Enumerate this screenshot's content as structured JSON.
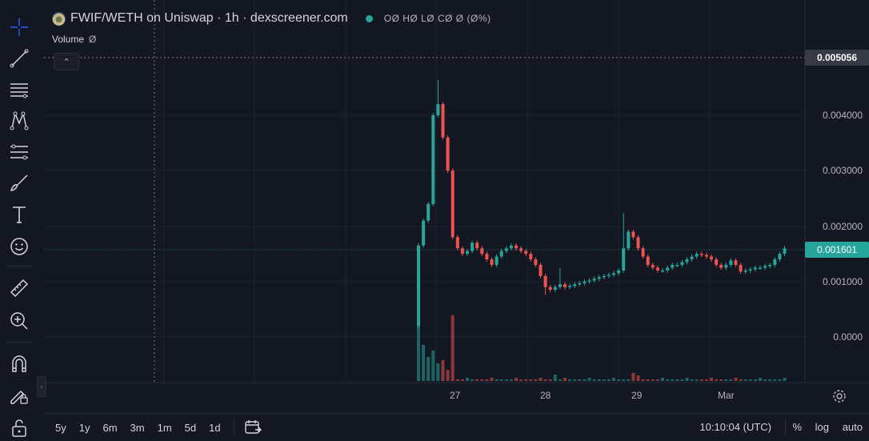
{
  "header": {
    "title": "FWIF/WETH on Uniswap · 1h · dexscreener.com",
    "ohlc": "OØ HØ LØ CØ Ø (Ø%)",
    "volume_label": "Volume",
    "volume_value": "Ø",
    "collapse_glyph": "⌃"
  },
  "toolbar": {
    "items": [
      "crosshair-icon",
      "trendline-icon",
      "horizontal-lines-icon",
      "pattern-icon",
      "fib-icon",
      "brush-icon",
      "text-icon",
      "emoji-icon",
      "ruler-icon",
      "zoom-in-icon",
      "magnet-icon",
      "lock-drawing-icon",
      "lock-icon"
    ],
    "collapse_glyph": "‹"
  },
  "colors": {
    "up": "#26a69a",
    "down": "#ef5350",
    "background": "#131722",
    "grid": "#1e222d",
    "price_tag": "#26a69a",
    "crosshair_tag": "#363a45"
  },
  "price_axis": {
    "labels": [
      "0.004000",
      "0.003000",
      "0.002000",
      "0.001000",
      "0.0000"
    ],
    "crosshair_price": "0.005056",
    "last_price": "0.001601"
  },
  "time_axis": {
    "labels": [
      "27",
      "28",
      "29",
      "Mar"
    ]
  },
  "bottom": {
    "timeframes": [
      "5y",
      "1y",
      "6m",
      "3m",
      "1m",
      "5d",
      "1d"
    ],
    "clock": "10:10:04 (UTC)",
    "percent": "%",
    "log": "log",
    "auto": "auto"
  },
  "chart_data": {
    "type": "candlestick",
    "interval": "1h",
    "price_axis": [
      0,
      0.005056
    ],
    "close_approx": [
      0.00165,
      0.0021,
      0.0024,
      0.004,
      0.0042,
      0.0036,
      0.003,
      0.0018,
      0.0016,
      0.0015,
      0.00155,
      0.0017,
      0.0016,
      0.0015,
      0.0014,
      0.0013,
      0.00145,
      0.00155,
      0.0016,
      0.00165,
      0.0016,
      0.00155,
      0.0015,
      0.0014,
      0.0013,
      0.0011,
      0.0009,
      0.00085,
      0.0009,
      0.00095,
      0.0009,
      0.00092,
      0.00095,
      0.00097,
      0.001,
      0.00102,
      0.00105,
      0.00108,
      0.0011,
      0.00112,
      0.00115,
      0.0012,
      0.0016,
      0.0019,
      0.0018,
      0.0016,
      0.00145,
      0.0013,
      0.00125,
      0.0012,
      0.0012,
      0.00125,
      0.0013,
      0.0013,
      0.00135,
      0.0014,
      0.00145,
      0.0015,
      0.00148,
      0.00145,
      0.0014,
      0.0013,
      0.00125,
      0.0013,
      0.00138,
      0.0013,
      0.00118,
      0.0012,
      0.00122,
      0.00125,
      0.00125,
      0.00128,
      0.0013,
      0.0014,
      0.0015,
      0.0016
    ]
  }
}
